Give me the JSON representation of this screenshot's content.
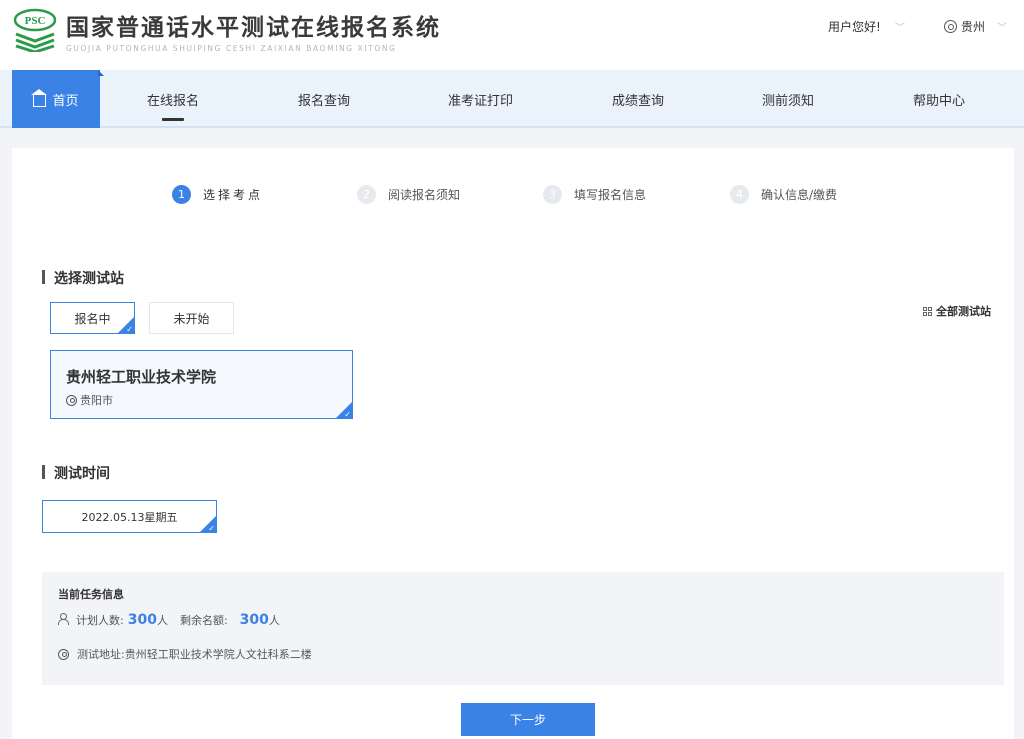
{
  "header": {
    "logo_badge": "PSC",
    "title": "国家普通话水平测试在线报名系统",
    "subtitle": "GUOJIA PUTONGHUA SHUIPING CESHI ZAIXIAN BAOMING XITONG",
    "greeting": "用户您好!",
    "region": "贵州"
  },
  "nav": {
    "home": "首页",
    "items": [
      "在线报名",
      "报名查询",
      "准考证打印",
      "成绩查询",
      "测前须知",
      "帮助中心"
    ]
  },
  "steps": [
    {
      "num": "1",
      "label": "选择考点"
    },
    {
      "num": "2",
      "label": "阅读报名须知"
    },
    {
      "num": "3",
      "label": "填写报名信息"
    },
    {
      "num": "4",
      "label": "确认信息/缴费"
    }
  ],
  "station": {
    "section_title": "选择测试站",
    "filters": [
      "报名中",
      "未开始"
    ],
    "all_sites": "全部测试站",
    "card": {
      "name": "贵州轻工职业技术学院",
      "city": "贵阳市"
    }
  },
  "time": {
    "section_title": "测试时间",
    "date": "2022.05.13星期五"
  },
  "task_info": {
    "title": "当前任务信息",
    "planned_label": "计划人数:",
    "planned_value": "300",
    "planned_unit": "人",
    "remaining_label": "剩余名额:",
    "remaining_value": "300",
    "remaining_unit": "人",
    "address_label": "测试地址:",
    "address": "贵州轻工职业技术学院人文社科系二楼"
  },
  "next_button": "下一步",
  "colors": {
    "accent": "#3b82e6",
    "nav_bg": "#eaf2fc",
    "logo_green": "#2c9a4a"
  }
}
